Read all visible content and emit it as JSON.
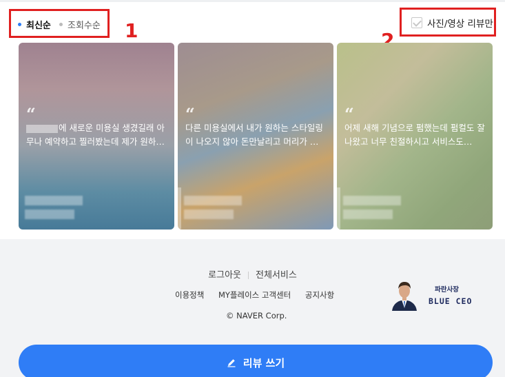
{
  "sort": {
    "latest_label": "최신순",
    "views_label": "조회수순"
  },
  "filter": {
    "label": "사진/영상 리뷰만",
    "checked": false
  },
  "annotations": {
    "one": "1",
    "two": "2"
  },
  "reviews": [
    {
      "text": "에 새로운 미용실 생겼길래 아무나 예약하고 찔러봤는데 제가 원하…"
    },
    {
      "text": "다른 미용실에서 내가 원하는 스타일링이 나오지 않아 돈만날리고 머리가 …"
    },
    {
      "text": "어제 새해 기념으로 펌했는데 펌컬도 잘나왔고 너무 친절하시고 서비스도…"
    }
  ],
  "footer": {
    "logout": "로그아웃",
    "all_services": "전체서비스",
    "policy": "이용정책",
    "my_place_center": "MY플레이스 고객센터",
    "notice": "공지사항",
    "copyright": "© NAVER Corp."
  },
  "logo": {
    "ko": "파란사장",
    "en": "BLUE CEO"
  },
  "review_button": {
    "label": "리뷰 쓰기"
  },
  "colors": {
    "accent": "#2f7df6",
    "annotation": "#e02020",
    "footer_bg": "#f2f3f5"
  }
}
